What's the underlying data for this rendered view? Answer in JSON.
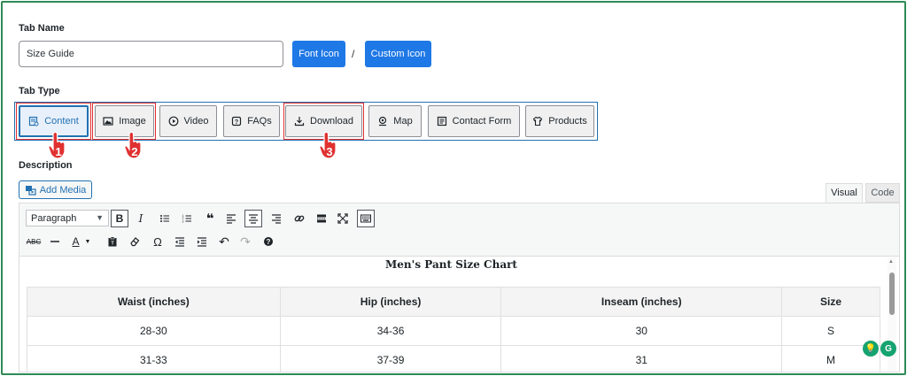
{
  "tab_name": {
    "label": "Tab Name",
    "value": "Size Guide",
    "font_icon_label": "Font Icon",
    "separator": "/",
    "custom_icon_label": "Custom Icon"
  },
  "tab_type": {
    "label": "Tab Type",
    "options": [
      {
        "label": "Content",
        "icon": "content-icon"
      },
      {
        "label": "Image",
        "icon": "image-icon"
      },
      {
        "label": "Video",
        "icon": "video-icon"
      },
      {
        "label": "FAQs",
        "icon": "faq-icon"
      },
      {
        "label": "Download",
        "icon": "download-icon"
      },
      {
        "label": "Map",
        "icon": "map-icon"
      },
      {
        "label": "Contact Form",
        "icon": "contact-form-icon"
      },
      {
        "label": "Products",
        "icon": "products-icon"
      }
    ],
    "selected": "Content"
  },
  "annotations": {
    "marker_1": "1",
    "marker_2": "2",
    "marker_3": "3",
    "highlight_color": "#e03131"
  },
  "description": {
    "label": "Description",
    "add_media_label": "Add Media",
    "visual_tab": "Visual",
    "code_tab": "Code",
    "format_select": "Paragraph"
  },
  "editor_content": {
    "title": "Men's Pant Size Chart",
    "headers": [
      "Waist (inches)",
      "Hip (inches)",
      "Inseam (inches)",
      "Size"
    ],
    "rows": [
      [
        "28-30",
        "34-36",
        "30",
        "S"
      ],
      [
        "31-33",
        "37-39",
        "31",
        "M"
      ]
    ]
  },
  "colors": {
    "accent": "#1e78e6",
    "frame": "#2e8b57"
  }
}
